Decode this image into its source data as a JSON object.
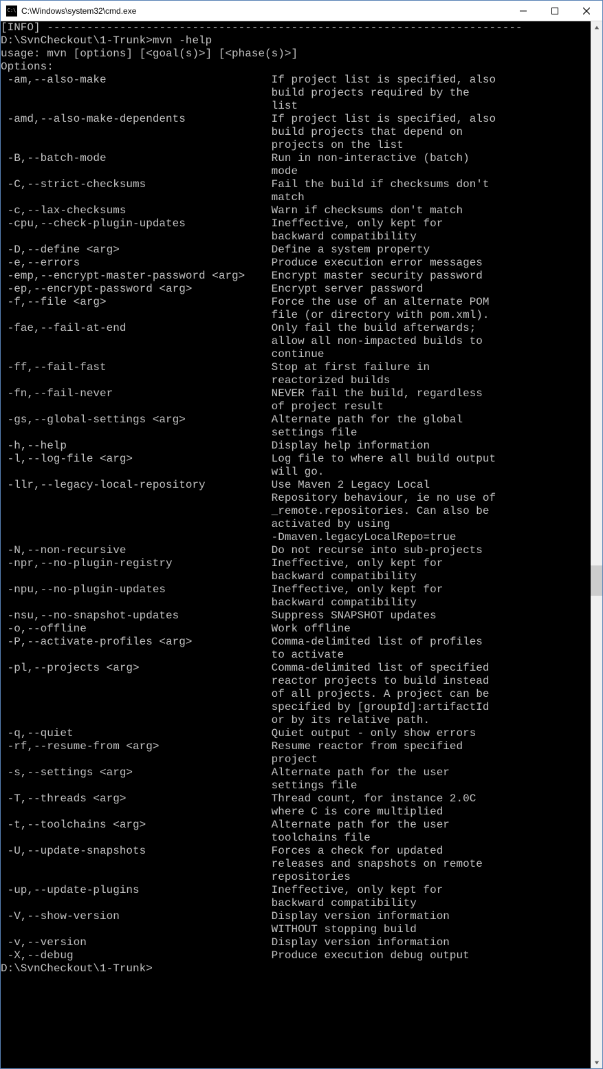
{
  "titlebar": {
    "title": "C:\\Windows\\system32\\cmd.exe"
  },
  "terminal": {
    "info_line": "[INFO] ------------------------------------------------------------------------",
    "prompt_cmd": "D:\\SvnCheckout\\1-Trunk>mvn -help",
    "blank": "",
    "usage": "usage: mvn [options] [<goal(s)>] [<phase(s)>]",
    "options_header": "Options:",
    "prompt_end": "D:\\SvnCheckout\\1-Trunk>",
    "options": [
      {
        "flags": "-am,--also-make",
        "desc": [
          "If project list is specified, also",
          "build projects required by the",
          "list"
        ]
      },
      {
        "flags": "-amd,--also-make-dependents",
        "desc": [
          "If project list is specified, also",
          "build projects that depend on",
          "projects on the list"
        ]
      },
      {
        "flags": "-B,--batch-mode",
        "desc": [
          "Run in non-interactive (batch)",
          "mode"
        ]
      },
      {
        "flags": "-C,--strict-checksums",
        "desc": [
          "Fail the build if checksums don't",
          "match"
        ]
      },
      {
        "flags": "-c,--lax-checksums",
        "desc": [
          "Warn if checksums don't match"
        ]
      },
      {
        "flags": "-cpu,--check-plugin-updates",
        "desc": [
          "Ineffective, only kept for",
          "backward compatibility"
        ]
      },
      {
        "flags": "-D,--define <arg>",
        "desc": [
          "Define a system property"
        ]
      },
      {
        "flags": "-e,--errors",
        "desc": [
          "Produce execution error messages"
        ]
      },
      {
        "flags": "-emp,--encrypt-master-password <arg>",
        "desc": [
          "Encrypt master security password"
        ]
      },
      {
        "flags": "-ep,--encrypt-password <arg>",
        "desc": [
          "Encrypt server password"
        ]
      },
      {
        "flags": "-f,--file <arg>",
        "desc": [
          "Force the use of an alternate POM",
          "file (or directory with pom.xml)."
        ]
      },
      {
        "flags": "-fae,--fail-at-end",
        "desc": [
          "Only fail the build afterwards;",
          "allow all non-impacted builds to",
          "continue"
        ]
      },
      {
        "flags": "-ff,--fail-fast",
        "desc": [
          "Stop at first failure in",
          "reactorized builds"
        ]
      },
      {
        "flags": "-fn,--fail-never",
        "desc": [
          "NEVER fail the build, regardless",
          "of project result"
        ]
      },
      {
        "flags": "-gs,--global-settings <arg>",
        "desc": [
          "Alternate path for the global",
          "settings file"
        ]
      },
      {
        "flags": "-h,--help",
        "desc": [
          "Display help information"
        ]
      },
      {
        "flags": "-l,--log-file <arg>",
        "desc": [
          "Log file to where all build output",
          "will go."
        ]
      },
      {
        "flags": "-llr,--legacy-local-repository",
        "desc": [
          "Use Maven 2 Legacy Local",
          "Repository behaviour, ie no use of",
          "_remote.repositories. Can also be",
          "activated by using",
          "-Dmaven.legacyLocalRepo=true"
        ]
      },
      {
        "flags": "-N,--non-recursive",
        "desc": [
          "Do not recurse into sub-projects"
        ]
      },
      {
        "flags": "-npr,--no-plugin-registry",
        "desc": [
          "Ineffective, only kept for",
          "backward compatibility"
        ]
      },
      {
        "flags": "-npu,--no-plugin-updates",
        "desc": [
          "Ineffective, only kept for",
          "backward compatibility"
        ]
      },
      {
        "flags": "-nsu,--no-snapshot-updates",
        "desc": [
          "Suppress SNAPSHOT updates"
        ]
      },
      {
        "flags": "-o,--offline",
        "desc": [
          "Work offline"
        ]
      },
      {
        "flags": "-P,--activate-profiles <arg>",
        "desc": [
          "Comma-delimited list of profiles",
          "to activate"
        ]
      },
      {
        "flags": "-pl,--projects <arg>",
        "desc": [
          "Comma-delimited list of specified",
          "reactor projects to build instead",
          "of all projects. A project can be",
          "specified by [groupId]:artifactId",
          "or by its relative path."
        ]
      },
      {
        "flags": "-q,--quiet",
        "desc": [
          "Quiet output - only show errors"
        ]
      },
      {
        "flags": "-rf,--resume-from <arg>",
        "desc": [
          "Resume reactor from specified",
          "project"
        ]
      },
      {
        "flags": "-s,--settings <arg>",
        "desc": [
          "Alternate path for the user",
          "settings file"
        ]
      },
      {
        "flags": "-T,--threads <arg>",
        "desc": [
          "Thread count, for instance 2.0C",
          "where C is core multiplied"
        ]
      },
      {
        "flags": "-t,--toolchains <arg>",
        "desc": [
          "Alternate path for the user",
          "toolchains file"
        ]
      },
      {
        "flags": "-U,--update-snapshots",
        "desc": [
          "Forces a check for updated",
          "releases and snapshots on remote",
          "repositories"
        ]
      },
      {
        "flags": "-up,--update-plugins",
        "desc": [
          "Ineffective, only kept for",
          "backward compatibility"
        ]
      },
      {
        "flags": "-V,--show-version",
        "desc": [
          "Display version information",
          "WITHOUT stopping build"
        ]
      },
      {
        "flags": "-v,--version",
        "desc": [
          "Display version information"
        ]
      },
      {
        "flags": "-X,--debug",
        "desc": [
          "Produce execution debug output"
        ]
      }
    ]
  },
  "scrollbar": {
    "thumb_top_pct": 52,
    "thumb_height_pct": 3
  }
}
